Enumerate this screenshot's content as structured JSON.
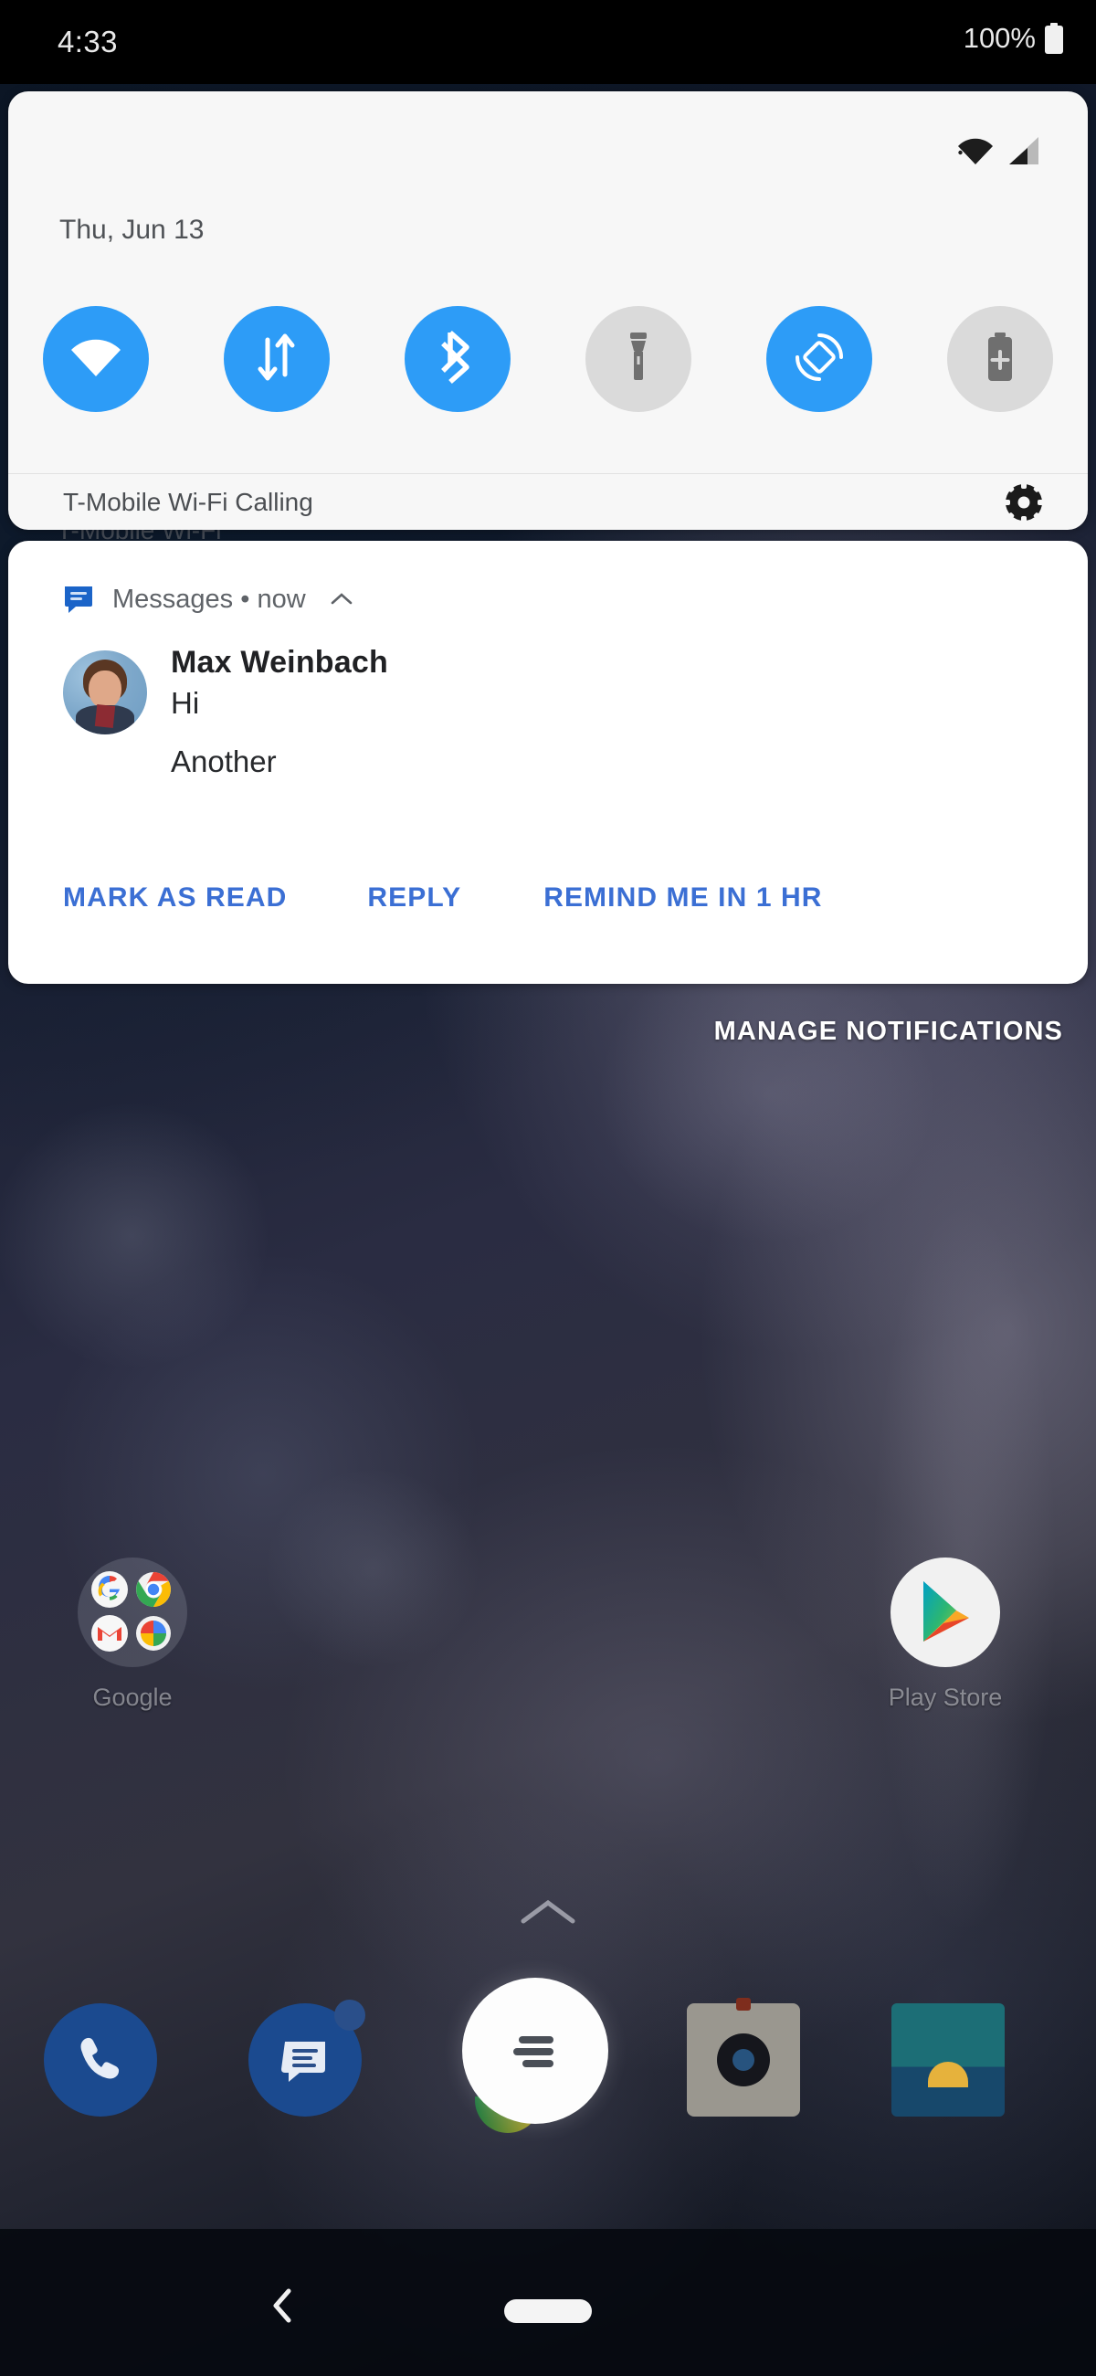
{
  "status_bar": {
    "time": "4:33",
    "battery_percent": "100%",
    "icons": [
      "battery-full-icon"
    ]
  },
  "quick_settings": {
    "date": "Thu, Jun 13",
    "status_icons": [
      "wifi-icon",
      "cell-signal-icon"
    ],
    "accent_on_color": "#2d9cf7",
    "off_color": "#dadada",
    "tiles": [
      {
        "name": "wifi-tile",
        "icon": "wifi-icon",
        "state": "on"
      },
      {
        "name": "mobile-data-tile",
        "icon": "data-transfer-icon",
        "state": "on"
      },
      {
        "name": "bluetooth-tile",
        "icon": "bluetooth-icon",
        "state": "on"
      },
      {
        "name": "flashlight-tile",
        "icon": "flashlight-icon",
        "state": "off"
      },
      {
        "name": "auto-rotate-tile",
        "icon": "auto-rotate-icon",
        "state": "on"
      },
      {
        "name": "battery-saver-tile",
        "icon": "battery-plus-icon",
        "state": "off"
      }
    ],
    "carrier_label": "T-Mobile Wi-Fi Calling",
    "settings_icon": "gear-icon",
    "ghost_text": "T-Mobile Wi-Fi"
  },
  "notification": {
    "app_icon": "messages-icon",
    "app_label": "Messages • now",
    "collapse_icon": "chevron-up-icon",
    "sender": "Max Weinbach",
    "message_lines": [
      "Hi",
      "Another"
    ],
    "avatar": "contact-avatar",
    "action_color": "#3b6fd4",
    "actions": [
      {
        "name": "mark-as-read-button",
        "label": "MARK AS READ"
      },
      {
        "name": "reply-button",
        "label": "REPLY"
      },
      {
        "name": "remind-me-button",
        "label": "REMIND ME IN 1 HR"
      }
    ]
  },
  "shade": {
    "manage_notifications_label": "MANAGE NOTIFICATIONS"
  },
  "home_screen": {
    "items": [
      {
        "name": "folder-google",
        "label": "Google",
        "icon": "google-folder-icon"
      },
      {
        "name": "app-play-store",
        "label": "Play Store",
        "icon": "play-store-icon"
      }
    ],
    "drawer_hint_icon": "chevron-up-icon"
  },
  "dock": {
    "items": [
      {
        "name": "dock-phone",
        "label": "Phone",
        "icon": "phone-icon"
      },
      {
        "name": "dock-messages",
        "label": "Messages",
        "icon": "messages-icon",
        "badge": true
      },
      {
        "name": "dock-assistant",
        "label": "Assistant",
        "icon": "assistant-lines-icon"
      },
      {
        "name": "dock-camera",
        "label": "Camera",
        "icon": "camera-icon"
      },
      {
        "name": "dock-gallery",
        "label": "Gallery",
        "icon": "gallery-icon"
      }
    ]
  },
  "nav_bar": {
    "back_icon": "chevron-left-icon",
    "home_pill": "home-pill-icon"
  }
}
